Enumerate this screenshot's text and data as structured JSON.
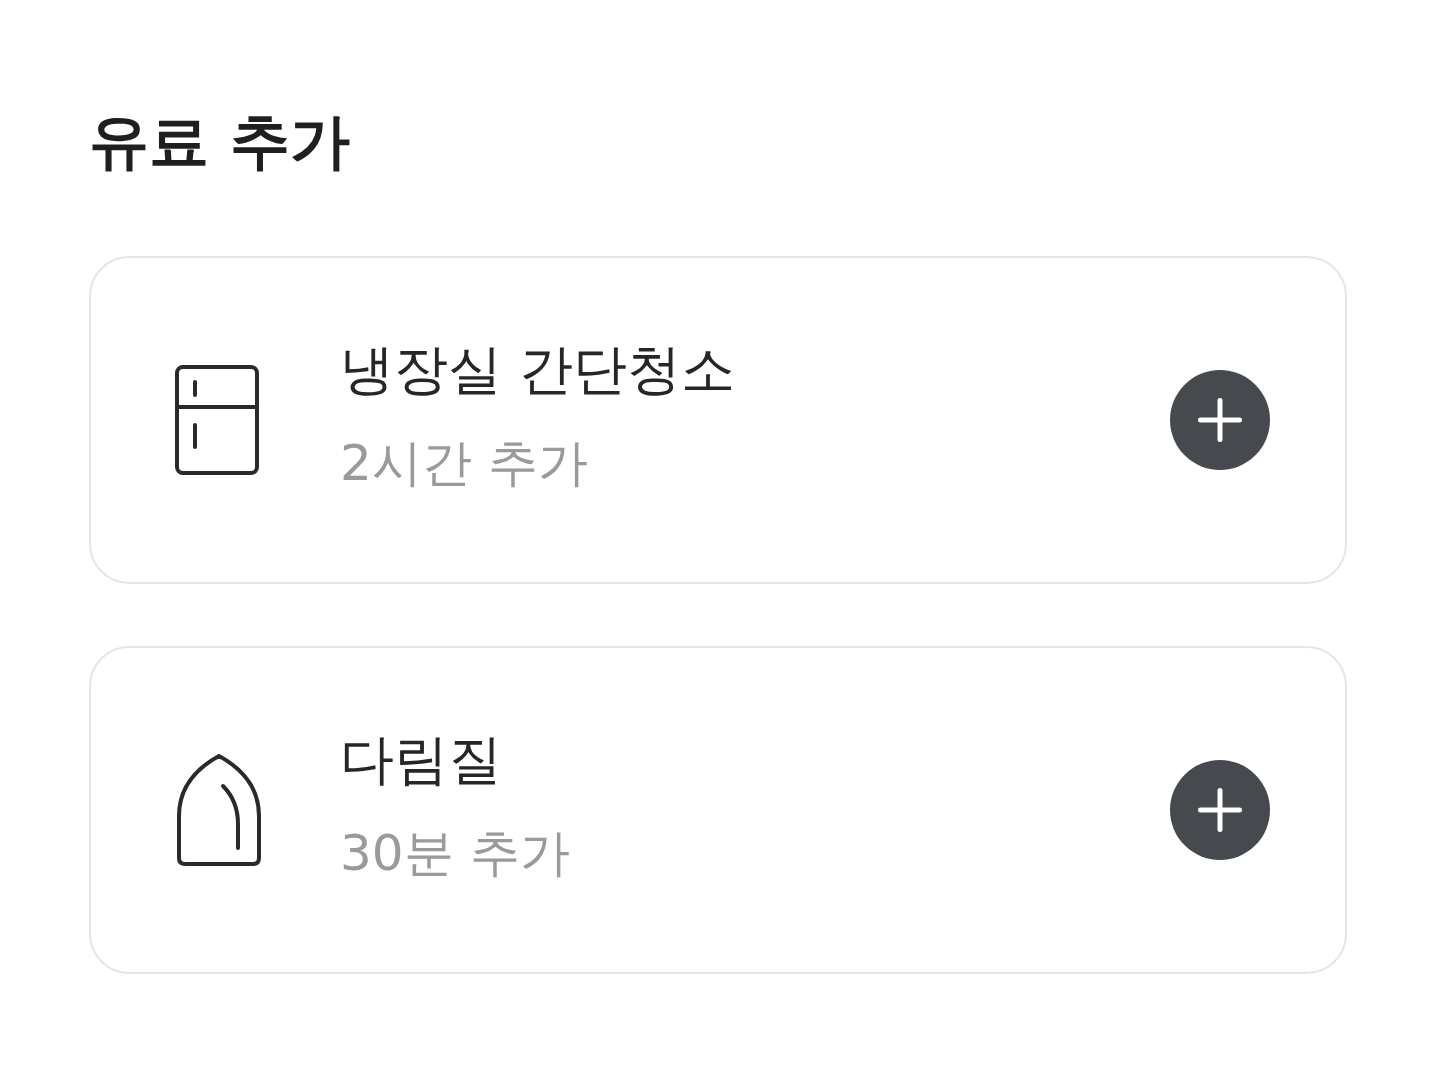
{
  "header": {
    "title": "유료 추가"
  },
  "options": [
    {
      "kind": "fridge",
      "name": "냉장실 간단청소",
      "detail": "2시간 추가"
    },
    {
      "kind": "iron",
      "name": "다림질",
      "detail": "30분 추가"
    }
  ]
}
